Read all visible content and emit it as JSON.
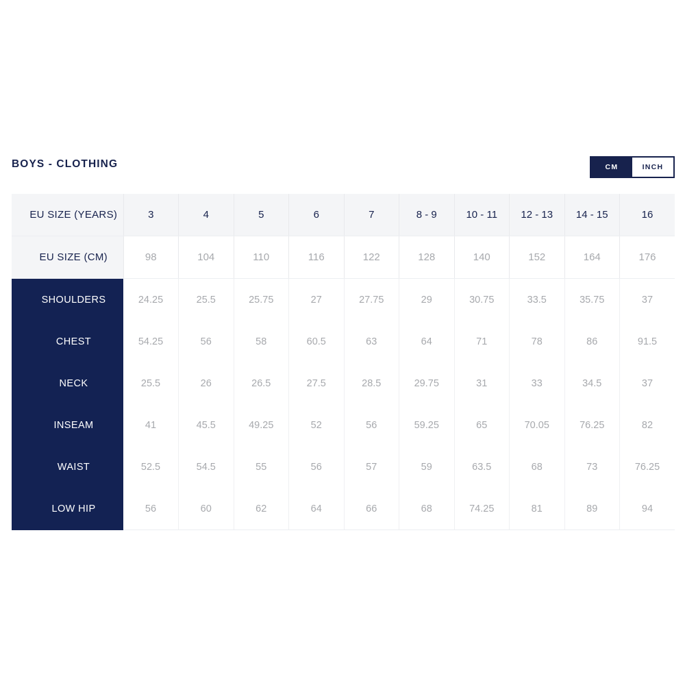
{
  "title": "BOYS - CLOTHING",
  "unit_toggle": {
    "options": [
      {
        "label": "CM",
        "active": true
      },
      {
        "label": "INCH",
        "active": false
      }
    ]
  },
  "table": {
    "header_rows": [
      {
        "label": "EU SIZE (YEARS)",
        "values": [
          "3",
          "4",
          "5",
          "6",
          "7",
          "8 - 9",
          "10 - 11",
          "12 - 13",
          "14 - 15",
          "16"
        ]
      },
      {
        "label": "EU SIZE (CM)",
        "values": [
          "98",
          "104",
          "110",
          "116",
          "122",
          "128",
          "140",
          "152",
          "164",
          "176"
        ]
      }
    ],
    "data_rows": [
      {
        "label": "SHOULDERS",
        "values": [
          "24.25",
          "25.5",
          "25.75",
          "27",
          "27.75",
          "29",
          "30.75",
          "33.5",
          "35.75",
          "37"
        ]
      },
      {
        "label": "CHEST",
        "values": [
          "54.25",
          "56",
          "58",
          "60.5",
          "63",
          "64",
          "71",
          "78",
          "86",
          "91.5"
        ]
      },
      {
        "label": "NECK",
        "values": [
          "25.5",
          "26",
          "26.5",
          "27.5",
          "28.5",
          "29.75",
          "31",
          "33",
          "34.5",
          "37"
        ]
      },
      {
        "label": "INSEAM",
        "values": [
          "41",
          "45.5",
          "49.25",
          "52",
          "56",
          "59.25",
          "65",
          "70.05",
          "76.25",
          "82"
        ]
      },
      {
        "label": "WAIST",
        "values": [
          "52.5",
          "54.5",
          "55",
          "56",
          "57",
          "59",
          "63.5",
          "68",
          "73",
          "76.25"
        ]
      },
      {
        "label": "LOW HIP",
        "values": [
          "56",
          "60",
          "62",
          "64",
          "66",
          "68",
          "74.25",
          "81",
          "89",
          "94"
        ]
      }
    ]
  },
  "colors": {
    "navy": "#132253",
    "title_navy": "#17224d",
    "header_bg": "#f4f5f7",
    "value_gray": "#a7a9ad",
    "border": "#eceef1"
  }
}
